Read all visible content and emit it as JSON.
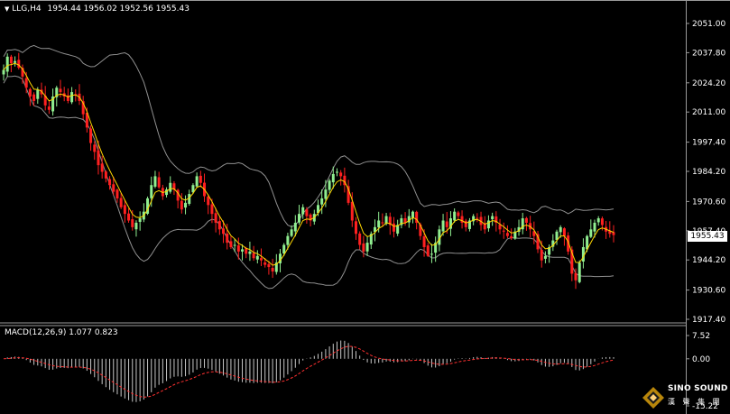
{
  "header": {
    "symbol": "LLG,H4",
    "ohlc": "1954.44 1956.02 1952.56 1955.43"
  },
  "price_axis": {
    "labels": [
      "2051.00",
      "2037.80",
      "2024.20",
      "2011.00",
      "1997.40",
      "1984.20",
      "1970.60",
      "1957.40",
      "1944.20",
      "1930.60",
      "1917.40"
    ],
    "current_price": "1955.43"
  },
  "macd_panel": {
    "label": "MACD(12,26,9) 1.077 0.823",
    "labels": [
      "7.52",
      "0.00",
      "-15.22"
    ]
  },
  "logo": {
    "line1": "SINO SOUND",
    "line2": "漢 聲 集 團"
  },
  "colors": {
    "background": "#000000",
    "bull_candle": "#90ee90",
    "bear_candle": "#ff2020",
    "ma_line": "#ffd700",
    "bands": "#909090",
    "signal": "#ff3030",
    "histogram": "#c8c8c8"
  },
  "chart_data": {
    "type": "candlestick",
    "timeframe": "H4",
    "ylim": [
      1917.4,
      2051.0
    ],
    "closes": [
      2030,
      2036,
      2033,
      2034,
      2031,
      2027,
      2022,
      2018,
      2016,
      2021,
      2019,
      2014,
      2012,
      2018,
      2022,
      2020,
      2018,
      2016,
      2020,
      2019,
      2016,
      2010,
      2004,
      1997,
      1993,
      1987,
      1984,
      1981,
      1978,
      1975,
      1972,
      1968,
      1965,
      1962,
      1959,
      1961,
      1963,
      1966,
      1972,
      1978,
      1982,
      1977,
      1973,
      1976,
      1979,
      1976,
      1971,
      1967,
      1970,
      1974,
      1978,
      1982,
      1979,
      1973,
      1969,
      1965,
      1961,
      1958,
      1956,
      1952,
      1950,
      1951,
      1948,
      1949,
      1947,
      1948,
      1945,
      1946,
      1944,
      1942,
      1941,
      1939,
      1943,
      1947,
      1951,
      1955,
      1958,
      1961,
      1965,
      1968,
      1964,
      1962,
      1965,
      1969,
      1972,
      1976,
      1980,
      1983,
      1984,
      1982,
      1978,
      1970,
      1962,
      1956,
      1951,
      1948,
      1952,
      1956,
      1959,
      1962,
      1961,
      1964,
      1960,
      1957,
      1960,
      1963,
      1961,
      1964,
      1966,
      1961,
      1955,
      1950,
      1946,
      1947,
      1952,
      1958,
      1962,
      1959,
      1963,
      1966,
      1964,
      1961,
      1959,
      1962,
      1964,
      1963,
      1960,
      1958,
      1962,
      1964,
      1961,
      1958,
      1957,
      1955,
      1954,
      1957,
      1959,
      1963,
      1961,
      1958,
      1955,
      1949,
      1944,
      1946,
      1950,
      1953,
      1957,
      1959,
      1955,
      1948,
      1938,
      1935,
      1943,
      1950,
      1955,
      1958,
      1961,
      1963,
      1960,
      1957,
      1956,
      1955.43
    ],
    "macd_ylim": [
      -15.22,
      7.52
    ]
  }
}
